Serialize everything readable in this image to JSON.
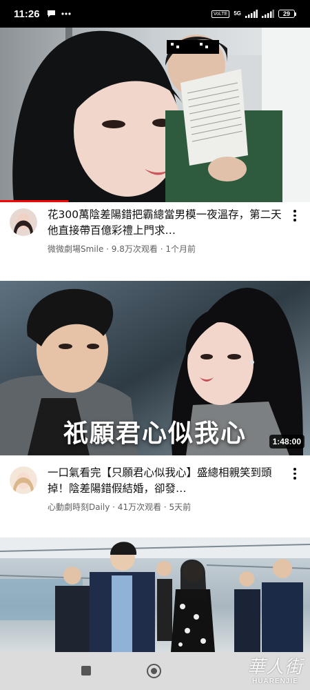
{
  "status_bar": {
    "time": "11:26",
    "volte": "VoLTE",
    "network": "5G",
    "battery": "29"
  },
  "videos": [
    {
      "title": "花300萬陰差陽錯把霸總當男模一夜溫存，第二天他直接帶百億彩禮上門求…",
      "channel": "微微劇場Smile",
      "views": "9.8万次观看",
      "age": "1个月前",
      "subtitle": "微微劇場Smile · 9.8万次观看 · 1个月前",
      "progress": 0.22
    },
    {
      "title": "一口氣看完【只願君心似我心】盛總相親笑到頭掉！陰差陽錯假結婚，卻發…",
      "channel": "心動劇時刻Daily",
      "views": "41万次观看",
      "age": "5天前",
      "subtitle": "心動劇時刻Daily · 41万次观看 · 5天前",
      "duration": "1:48:00",
      "overlay_text": "祇願君心似我心"
    }
  ],
  "watermark": {
    "cn": "華人街",
    "en": "HUARENJIE"
  },
  "colors": {
    "progress": "#ff0000",
    "secondary_text": "#606060",
    "nav_bar": "#dcdcdc"
  }
}
